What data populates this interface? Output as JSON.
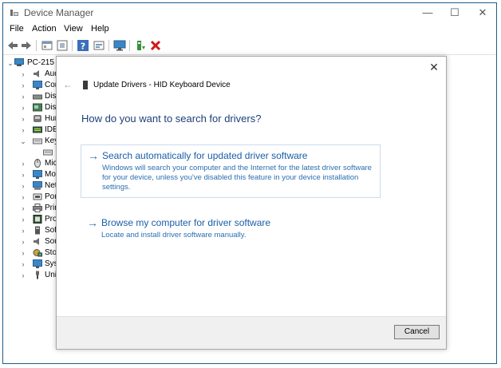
{
  "window": {
    "title": "Device Manager",
    "minimize": "—",
    "maximize": "☐",
    "close": "✕"
  },
  "menu": [
    "File",
    "Action",
    "View",
    "Help"
  ],
  "tree": {
    "root": "PC-215",
    "items": [
      {
        "label": "Aud",
        "icon": "speaker-icon",
        "expanded": false
      },
      {
        "label": "Cor",
        "icon": "monitor-icon",
        "expanded": false
      },
      {
        "label": "Disl",
        "icon": "disk-icon",
        "expanded": false
      },
      {
        "label": "Disp",
        "icon": "display-adapter-icon",
        "expanded": false
      },
      {
        "label": "Hun",
        "icon": "hid-icon",
        "expanded": false
      },
      {
        "label": "IDE",
        "icon": "ide-icon",
        "expanded": false
      },
      {
        "label": "Key",
        "icon": "keyboard-icon",
        "expanded": true
      },
      {
        "label": "",
        "icon": "keyboard-device-icon",
        "expanded": null
      },
      {
        "label": "Mic",
        "icon": "mouse-icon",
        "expanded": false
      },
      {
        "label": "Mo",
        "icon": "monitor-icon",
        "expanded": false
      },
      {
        "label": "Net",
        "icon": "network-icon",
        "expanded": false
      },
      {
        "label": "Por",
        "icon": "port-icon",
        "expanded": false
      },
      {
        "label": "Prir",
        "icon": "printer-icon",
        "expanded": false
      },
      {
        "label": "Pro",
        "icon": "processor-icon",
        "expanded": false
      },
      {
        "label": "Sof",
        "icon": "software-icon",
        "expanded": false
      },
      {
        "label": "Sou",
        "icon": "sound-icon",
        "expanded": false
      },
      {
        "label": "Sto",
        "icon": "storage-icon",
        "expanded": false
      },
      {
        "label": "Syst",
        "icon": "system-icon",
        "expanded": false
      },
      {
        "label": "Uni",
        "icon": "usb-icon",
        "expanded": false
      }
    ]
  },
  "dialog": {
    "close": "✕",
    "back": "←",
    "title": "Update Drivers - HID Keyboard Device",
    "heading": "How do you want to search for drivers?",
    "options": [
      {
        "arrow": "→",
        "title": "Search automatically for updated driver software",
        "description": "Windows will search your computer and the Internet for the latest driver software for your device, unless you've disabled this feature in your device installation settings."
      },
      {
        "arrow": "→",
        "title": "Browse my computer for driver software",
        "description": "Locate and install driver software manually."
      }
    ],
    "cancel": "Cancel"
  },
  "colors": {
    "link": "#1a5ea8",
    "heading": "#1e3f78",
    "frame_border": "#1e5e8c"
  }
}
